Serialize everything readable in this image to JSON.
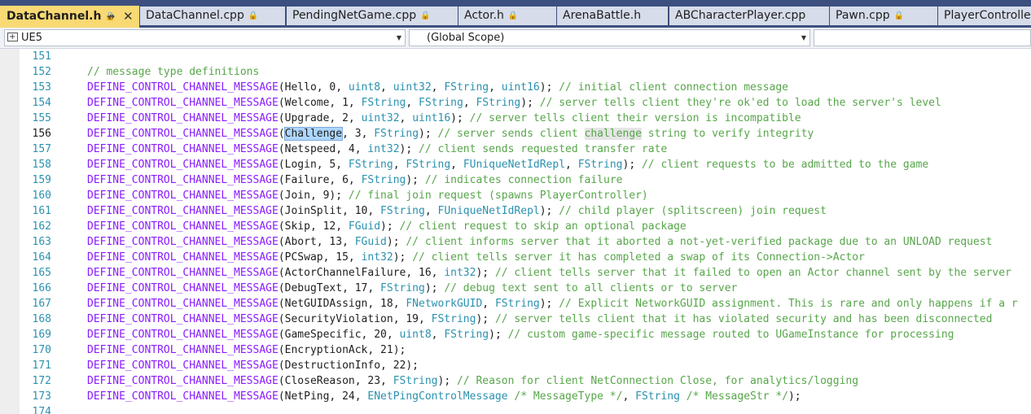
{
  "tabs": [
    {
      "label": "DataChannel.h",
      "active": true,
      "locked": true
    },
    {
      "label": "DataChannel.cpp",
      "locked": true
    },
    {
      "label": "PendingNetGame.cpp",
      "locked": true
    },
    {
      "label": "Actor.h",
      "locked": true
    },
    {
      "label": "ArenaBattle.h",
      "locked": false
    },
    {
      "label": "ABCharacterPlayer.cpp",
      "locked": false
    },
    {
      "label": "Pawn.cpp",
      "locked": true
    },
    {
      "label": "PlayerController.c",
      "locked": false
    }
  ],
  "nav": {
    "project": "UE5",
    "scope": "(Global Scope)",
    "member": ""
  },
  "macro": "DEFINE_CONTROL_CHANNEL_MESSAGE",
  "current_line": 156,
  "lines": [
    {
      "n": "151",
      "segs": []
    },
    {
      "n": "152",
      "segs": [
        [
          "c",
          "// message type definitions"
        ]
      ]
    },
    {
      "n": "153",
      "segs": [
        [
          "m",
          ""
        ],
        [
          "p",
          "(Hello, 0, "
        ],
        [
          "t",
          "uint8"
        ],
        [
          "p",
          ", "
        ],
        [
          "t",
          "uint32"
        ],
        [
          "p",
          ", "
        ],
        [
          "t",
          "FString"
        ],
        [
          "p",
          ", "
        ],
        [
          "t",
          "uint16"
        ],
        [
          "p",
          "); "
        ],
        [
          "c",
          "// initial client connection message"
        ]
      ]
    },
    {
      "n": "154",
      "segs": [
        [
          "m",
          ""
        ],
        [
          "p",
          "(Welcome, 1, "
        ],
        [
          "t",
          "FString"
        ],
        [
          "p",
          ", "
        ],
        [
          "t",
          "FString"
        ],
        [
          "p",
          ", "
        ],
        [
          "t",
          "FString"
        ],
        [
          "p",
          "); "
        ],
        [
          "c",
          "// server tells client they're ok'ed to load the server's level"
        ]
      ]
    },
    {
      "n": "155",
      "segs": [
        [
          "m",
          ""
        ],
        [
          "p",
          "(Upgrade, 2, "
        ],
        [
          "t",
          "uint32"
        ],
        [
          "p",
          ", "
        ],
        [
          "t",
          "uint16"
        ],
        [
          "p",
          "); "
        ],
        [
          "c",
          "// server tells client their version is incompatible"
        ]
      ]
    },
    {
      "n": "156",
      "segs": [
        [
          "m",
          ""
        ],
        [
          "p",
          "("
        ],
        [
          "s",
          "Challenge"
        ],
        [
          "p",
          ", 3, "
        ],
        [
          "t",
          "FString"
        ],
        [
          "p",
          "); "
        ],
        [
          "c",
          "// server sends client "
        ],
        [
          "h",
          "challenge"
        ],
        [
          "c",
          " string to verify integrity"
        ]
      ]
    },
    {
      "n": "157",
      "segs": [
        [
          "m",
          ""
        ],
        [
          "p",
          "(Netspeed, 4, "
        ],
        [
          "t",
          "int32"
        ],
        [
          "p",
          "); "
        ],
        [
          "c",
          "// client sends requested transfer rate"
        ]
      ]
    },
    {
      "n": "158",
      "segs": [
        [
          "m",
          ""
        ],
        [
          "p",
          "(Login, 5, "
        ],
        [
          "t",
          "FString"
        ],
        [
          "p",
          ", "
        ],
        [
          "t",
          "FString"
        ],
        [
          "p",
          ", "
        ],
        [
          "t",
          "FUniqueNetIdRepl"
        ],
        [
          "p",
          ", "
        ],
        [
          "t",
          "FString"
        ],
        [
          "p",
          "); "
        ],
        [
          "c",
          "// client requests to be admitted to the game"
        ]
      ]
    },
    {
      "n": "159",
      "segs": [
        [
          "m",
          ""
        ],
        [
          "p",
          "(Failure, 6, "
        ],
        [
          "t",
          "FString"
        ],
        [
          "p",
          "); "
        ],
        [
          "c",
          "// indicates connection failure"
        ]
      ]
    },
    {
      "n": "160",
      "segs": [
        [
          "m",
          ""
        ],
        [
          "p",
          "(Join, 9); "
        ],
        [
          "c",
          "// final join request (spawns PlayerController)"
        ]
      ]
    },
    {
      "n": "161",
      "segs": [
        [
          "m",
          ""
        ],
        [
          "p",
          "(JoinSplit, 10, "
        ],
        [
          "t",
          "FString"
        ],
        [
          "p",
          ", "
        ],
        [
          "t",
          "FUniqueNetIdRepl"
        ],
        [
          "p",
          "); "
        ],
        [
          "c",
          "// child player (splitscreen) join request"
        ]
      ]
    },
    {
      "n": "162",
      "segs": [
        [
          "m",
          ""
        ],
        [
          "p",
          "(Skip, 12, "
        ],
        [
          "t",
          "FGuid"
        ],
        [
          "p",
          "); "
        ],
        [
          "c",
          "// client request to skip an optional package"
        ]
      ]
    },
    {
      "n": "163",
      "segs": [
        [
          "m",
          ""
        ],
        [
          "p",
          "(Abort, 13, "
        ],
        [
          "t",
          "FGuid"
        ],
        [
          "p",
          "); "
        ],
        [
          "c",
          "// client informs server that it aborted a not-yet-verified package due to an UNLOAD request"
        ]
      ]
    },
    {
      "n": "164",
      "segs": [
        [
          "m",
          ""
        ],
        [
          "p",
          "(PCSwap, 15, "
        ],
        [
          "t",
          "int32"
        ],
        [
          "p",
          "); "
        ],
        [
          "c",
          "// client tells server it has completed a swap of its Connection->Actor"
        ]
      ]
    },
    {
      "n": "165",
      "segs": [
        [
          "m",
          ""
        ],
        [
          "p",
          "(ActorChannelFailure, 16, "
        ],
        [
          "t",
          "int32"
        ],
        [
          "p",
          "); "
        ],
        [
          "c",
          "// client tells server that it failed to open an Actor channel sent by the server"
        ]
      ]
    },
    {
      "n": "166",
      "segs": [
        [
          "m",
          ""
        ],
        [
          "p",
          "(DebugText, 17, "
        ],
        [
          "t",
          "FString"
        ],
        [
          "p",
          "); "
        ],
        [
          "c",
          "// debug text sent to all clients or to server"
        ]
      ]
    },
    {
      "n": "167",
      "segs": [
        [
          "m",
          ""
        ],
        [
          "p",
          "(NetGUIDAssign, 18, "
        ],
        [
          "t",
          "FNetworkGUID"
        ],
        [
          "p",
          ", "
        ],
        [
          "t",
          "FString"
        ],
        [
          "p",
          "); "
        ],
        [
          "c",
          "// Explicit NetworkGUID assignment. This is rare and only happens if a r"
        ]
      ]
    },
    {
      "n": "168",
      "segs": [
        [
          "m",
          ""
        ],
        [
          "p",
          "(SecurityViolation, 19, "
        ],
        [
          "t",
          "FString"
        ],
        [
          "p",
          "); "
        ],
        [
          "c",
          "// server tells client that it has violated security and has been disconnected"
        ]
      ]
    },
    {
      "n": "169",
      "segs": [
        [
          "m",
          ""
        ],
        [
          "p",
          "(GameSpecific, 20, "
        ],
        [
          "t",
          "uint8"
        ],
        [
          "p",
          ", "
        ],
        [
          "t",
          "FString"
        ],
        [
          "p",
          "); "
        ],
        [
          "c",
          "// custom game-specific message routed to UGameInstance for processing"
        ]
      ]
    },
    {
      "n": "170",
      "segs": [
        [
          "m",
          ""
        ],
        [
          "p",
          "(EncryptionAck, 21);"
        ]
      ]
    },
    {
      "n": "171",
      "segs": [
        [
          "m",
          ""
        ],
        [
          "p",
          "(DestructionInfo, 22);"
        ]
      ]
    },
    {
      "n": "172",
      "segs": [
        [
          "m",
          ""
        ],
        [
          "p",
          "(CloseReason, 23, "
        ],
        [
          "t",
          "FString"
        ],
        [
          "p",
          "); "
        ],
        [
          "c",
          "// Reason for client NetConnection Close, for analytics/logging"
        ]
      ]
    },
    {
      "n": "173",
      "segs": [
        [
          "m",
          ""
        ],
        [
          "p",
          "(NetPing, 24, "
        ],
        [
          "t",
          "ENetPingControlMessage"
        ],
        [
          "p",
          " "
        ],
        [
          "c",
          "/* MessageType */"
        ],
        [
          "p",
          ", "
        ],
        [
          "t",
          "FString"
        ],
        [
          "p",
          " "
        ],
        [
          "c",
          "/* MessageStr */"
        ],
        [
          "p",
          ");"
        ]
      ]
    },
    {
      "n": "174",
      "segs": []
    }
  ]
}
